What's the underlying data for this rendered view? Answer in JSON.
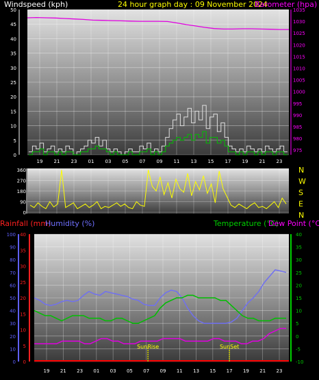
{
  "header": {
    "left": "Windspeed (kph)",
    "center": "24 hour graph day : 09 November 2024",
    "right": "Barometer (hpa)"
  },
  "labels": {
    "rain": "Rainfall (mm)",
    "humidity": "Humidity (%)",
    "temperature": "Temperature (°C)",
    "dewpoint": "Dew Point (°C)",
    "sunrise": "SunRise",
    "sunset": "SunSet"
  },
  "colors": {
    "wind_avg": "#00c000",
    "wind_gust": "#e0e0e0",
    "barometer": "#e000e0",
    "direction": "#ffff00",
    "rain": "#ff0000",
    "humidity": "#7070f0",
    "temperature": "#00c000",
    "dewpoint": "#e000e0",
    "axis_left_top": "#ffffff",
    "axis_right_top": "#ff00ff",
    "axis_rain": "#ff2020",
    "axis_humidity": "#6060ff",
    "axis_temp": "#00d000"
  },
  "time_ticks": [
    "19",
    "21",
    "23",
    "01",
    "03",
    "05",
    "07",
    "09",
    "11",
    "13",
    "15",
    "17",
    "19",
    "21",
    "23"
  ],
  "chart_data": [
    {
      "type": "line",
      "name": "wind-barometer",
      "x_ticks": [
        "19",
        "21",
        "23",
        "01",
        "03",
        "05",
        "07",
        "09",
        "11",
        "13",
        "15",
        "17",
        "19",
        "21",
        "23"
      ],
      "y_left": {
        "ticks": [
          0,
          5,
          10,
          15,
          20,
          25,
          30,
          35,
          40,
          45,
          50
        ],
        "lim": [
          0,
          50
        ]
      },
      "y_right": {
        "ticks": [
          975,
          980,
          985,
          990,
          995,
          1000,
          1005,
          1010,
          1015,
          1020,
          1025,
          1030,
          1035
        ],
        "lim": [
          973,
          1035
        ]
      },
      "series": [
        {
          "key": "gust",
          "values": [
            1,
            3,
            2,
            4,
            1,
            2,
            3,
            1,
            2,
            1,
            3,
            2,
            0,
            1,
            2,
            3,
            5,
            4,
            6,
            3,
            5,
            2,
            1,
            2,
            1,
            0,
            1,
            2,
            1,
            1,
            3,
            2,
            4,
            1,
            2,
            1,
            3,
            6,
            9,
            12,
            14,
            10,
            13,
            16,
            11,
            15,
            12,
            17,
            9,
            13,
            14,
            8,
            11,
            6,
            3,
            2,
            1,
            2,
            1,
            3,
            2,
            1,
            2,
            1,
            3,
            2,
            1,
            2,
            3,
            1
          ]
        },
        {
          "key": "avg",
          "values": [
            0,
            1,
            1,
            2,
            0,
            1,
            1,
            0,
            1,
            0,
            1,
            1,
            0,
            0,
            1,
            1,
            2,
            2,
            3,
            2,
            2,
            1,
            0,
            1,
            0,
            0,
            0,
            1,
            0,
            0,
            1,
            1,
            2,
            0,
            1,
            0,
            1,
            3,
            4,
            5,
            6,
            5,
            6,
            7,
            5,
            7,
            6,
            8,
            4,
            6,
            6,
            4,
            5,
            3,
            1,
            1,
            0,
            1,
            0,
            1,
            1,
            0,
            1,
            0,
            1,
            1,
            0,
            1,
            1,
            0
          ]
        },
        {
          "key": "barometer",
          "values": [
            1031.5,
            1031.6,
            1031.5,
            1031.4,
            1031.2,
            1031.0,
            1030.8,
            1030.5,
            1030.4,
            1030.3,
            1030.2,
            1030.1,
            1030.0,
            1030.0,
            1030.0,
            1029.9,
            1029.3,
            1028.6,
            1028.0,
            1027.4,
            1026.9,
            1026.7,
            1026.7,
            1026.8,
            1026.8,
            1026.7,
            1026.6,
            1026.5,
            1026.5
          ]
        }
      ]
    },
    {
      "type": "scatter",
      "name": "wind-direction",
      "y_ticks": [
        0,
        90,
        180,
        270,
        360
      ],
      "y_lim": [
        0,
        360
      ],
      "compass": [
        "N",
        "W",
        "S",
        "E",
        "N"
      ],
      "values": [
        60,
        40,
        80,
        50,
        30,
        90,
        45,
        70,
        360,
        40,
        60,
        80,
        30,
        50,
        70,
        40,
        60,
        90,
        30,
        50,
        40,
        60,
        80,
        50,
        70,
        40,
        30,
        90,
        60,
        50,
        360,
        220,
        180,
        300,
        150,
        250,
        120,
        280,
        200,
        170,
        330,
        140,
        260,
        190,
        310,
        160,
        240,
        80,
        350,
        200,
        130,
        60,
        40,
        70,
        50,
        30,
        60,
        80,
        40,
        50,
        30,
        60,
        90,
        40,
        120,
        70
      ]
    },
    {
      "type": "line",
      "name": "rain-humidity-temperature",
      "x_ticks": [
        "19",
        "21",
        "23",
        "01",
        "03",
        "05",
        "07",
        "09",
        "11",
        "13",
        "15",
        "17",
        "19",
        "21",
        "23"
      ],
      "y_humidity": {
        "ticks": [
          0,
          10,
          20,
          30,
          40,
          50,
          60,
          70,
          80,
          90,
          100
        ],
        "lim": [
          0,
          100
        ]
      },
      "y_rain": {
        "ticks": [
          0,
          5,
          10,
          15,
          20,
          25,
          30,
          35,
          40
        ],
        "lim": [
          0,
          40
        ]
      },
      "y_temp": {
        "ticks": [
          -10,
          -5,
          0,
          5,
          10,
          15,
          20,
          25,
          30,
          35,
          40
        ],
        "lim": [
          -10,
          40
        ]
      },
      "annotations": [
        {
          "text": "SunRise",
          "x_hour": 7.2
        },
        {
          "text": "SunSet",
          "x_hour": 17.0
        }
      ],
      "series": [
        {
          "key": "humidity",
          "values": [
            50,
            48,
            45,
            44,
            45,
            47,
            48,
            47,
            48,
            52,
            55,
            53,
            52,
            55,
            54,
            53,
            52,
            51,
            49,
            48,
            45,
            44,
            44,
            50,
            54,
            56,
            55,
            50,
            42,
            36,
            32,
            30,
            30,
            30,
            30,
            30,
            31,
            34,
            40,
            46,
            50,
            55,
            62,
            67,
            72,
            71,
            70
          ]
        },
        {
          "key": "temperature",
          "values": [
            10,
            9,
            8,
            8,
            7,
            6,
            7,
            8,
            8,
            8,
            7,
            7,
            7,
            6,
            6,
            7,
            7,
            6,
            5,
            5,
            6,
            7,
            8,
            11,
            13,
            14,
            15,
            15,
            16,
            16,
            15,
            15,
            15,
            15,
            14,
            14,
            12,
            10,
            8,
            7,
            7,
            6,
            6,
            6,
            7,
            7,
            7
          ]
        },
        {
          "key": "dewpoint",
          "values": [
            -3,
            -3,
            -3,
            -3,
            -3,
            -2,
            -2,
            -2,
            -2,
            -3,
            -3,
            -2,
            -1,
            -1,
            -2,
            -2,
            -3,
            -3,
            -3,
            -2,
            -2,
            -2,
            -2,
            -1,
            -1,
            -1,
            -1,
            -2,
            -2,
            -2,
            -2,
            -2,
            -1,
            -1,
            -2,
            -2,
            -2,
            -3,
            -3,
            -2,
            -2,
            -1,
            1,
            2,
            3,
            3
          ]
        },
        {
          "key": "rain",
          "values": [
            0,
            0,
            0,
            0,
            0,
            0,
            0,
            0,
            0,
            0,
            0,
            0,
            0,
            0,
            0,
            0,
            0,
            0,
            0,
            0,
            0,
            0,
            0,
            0,
            0,
            0,
            0,
            0,
            0,
            0,
            0,
            0,
            0,
            0,
            0,
            0,
            0,
            0,
            0,
            0,
            0,
            0,
            0,
            0,
            0,
            0,
            0
          ]
        }
      ]
    }
  ]
}
